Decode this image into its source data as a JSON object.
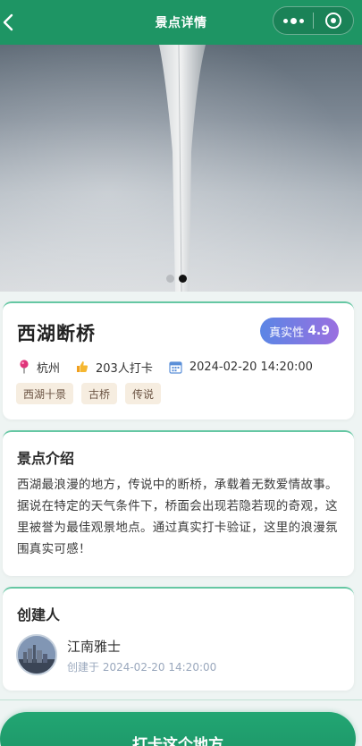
{
  "navbar": {
    "title": "景点详情",
    "back_icon": "chevron-left-icon",
    "more_icon": "more-dots-icon",
    "close_icon": "target-circle-icon",
    "color": "#1e9564"
  },
  "carousel": {
    "slide_count": 2,
    "active_index": 1
  },
  "spot": {
    "name": "西湖断桥",
    "authenticity_label": "真实性",
    "authenticity_score": "4.9",
    "location": "杭州",
    "checkins": "203人打卡",
    "created_time": "2024-02-20 14:20:00",
    "tags": [
      "西湖十景",
      "古桥",
      "传说"
    ]
  },
  "intro": {
    "title": "景点介绍",
    "text": "西湖最浪漫的地方，传说中的断桥，承载着无数爱情故事。据说在特定的天气条件下，桥面会出现若隐若现的奇观，这里被誉为最佳观景地点。通过真实打卡验证，这里的浪漫氛围真实可感！"
  },
  "creator": {
    "title": "创建人",
    "name": "江南雅士",
    "created_at": "创建于 2024-02-20 14:20:00"
  },
  "action": {
    "label": "打卡这个地方",
    "color": "#1c9466"
  }
}
